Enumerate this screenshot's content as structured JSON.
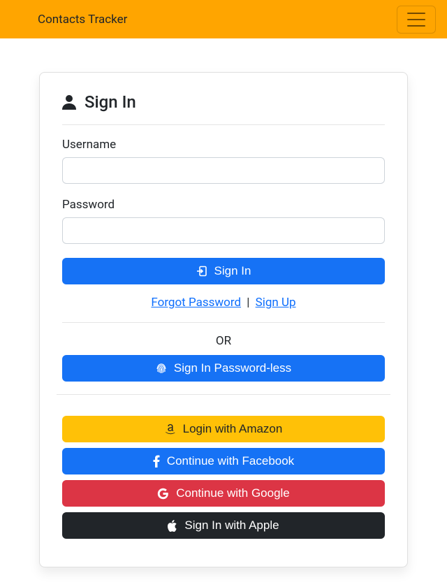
{
  "navbar": {
    "brand": "Contacts Tracker"
  },
  "signin": {
    "heading": "Sign In",
    "username_label": "Username",
    "username_value": "",
    "password_label": "Password",
    "password_value": "",
    "signin_button": "Sign In",
    "forgot_password": "Forgot Password",
    "signup": "Sign Up",
    "or_text": "OR",
    "passwordless_button": "Sign In Password-less"
  },
  "social": {
    "amazon": "Login with Amazon",
    "facebook": "Continue with Facebook",
    "google": "Continue with Google",
    "apple": "Sign In with Apple"
  }
}
